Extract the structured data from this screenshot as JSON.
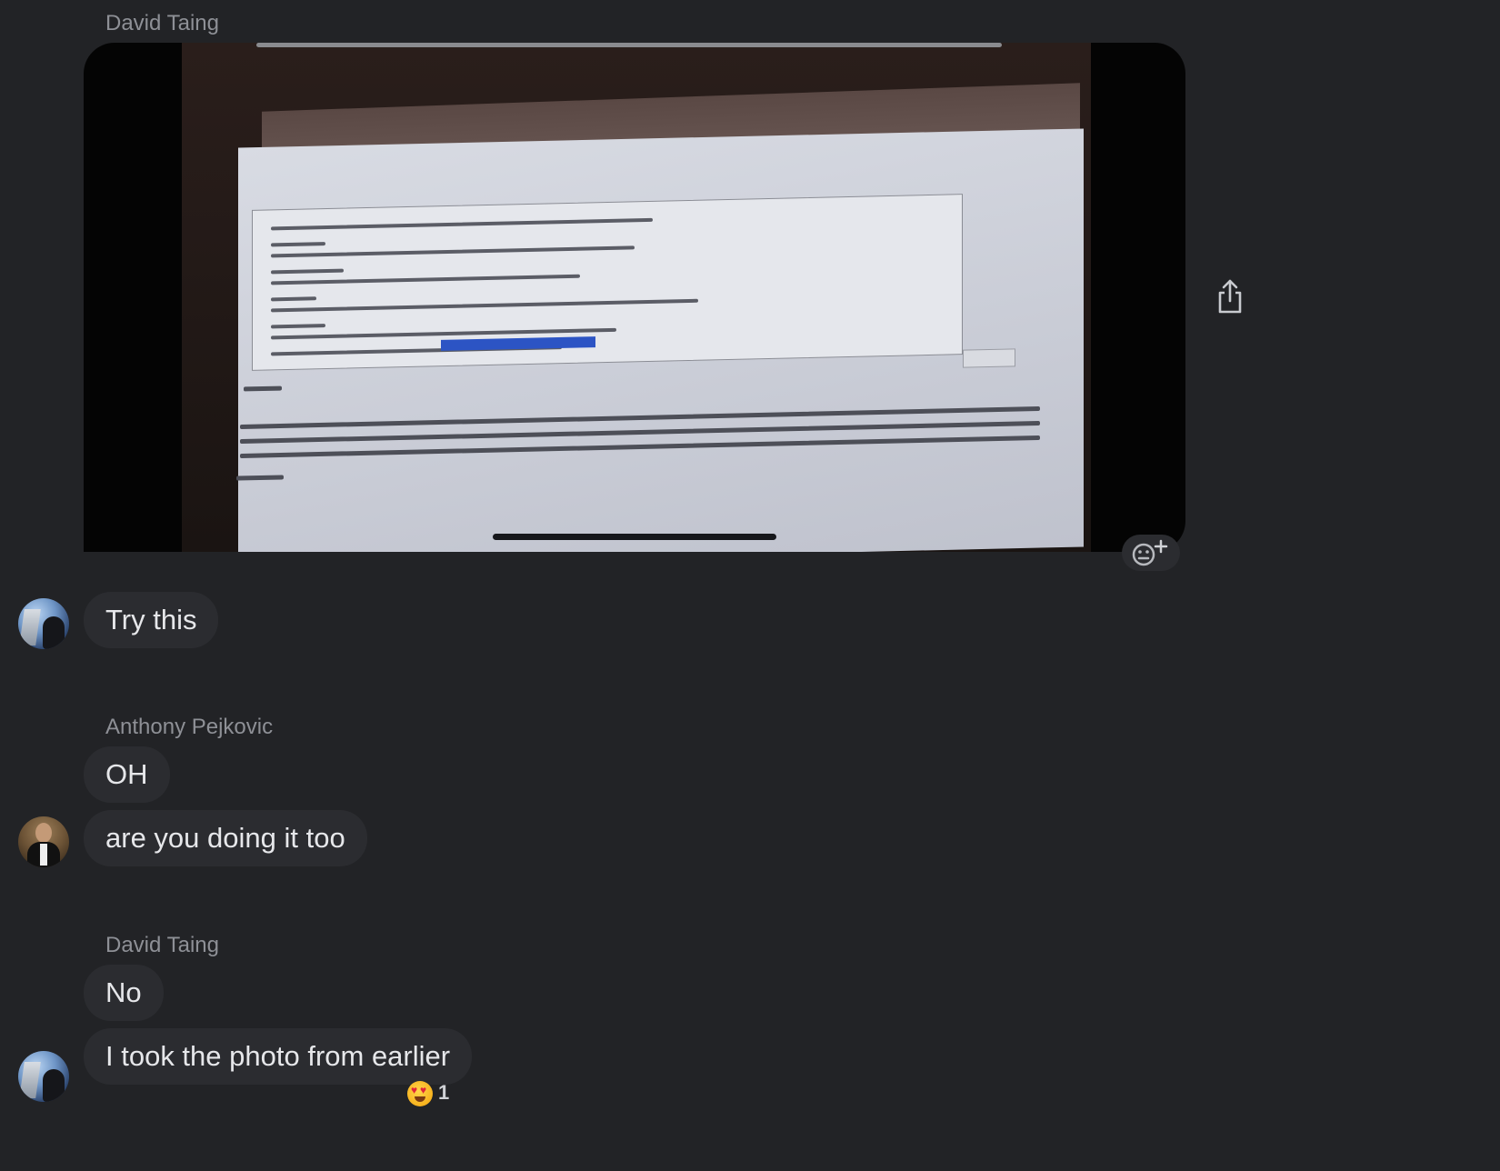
{
  "messages": [
    {
      "sender": "David Taing",
      "type": "photo"
    },
    {
      "text": "Try this"
    },
    {
      "sender": "Anthony Pejkovic"
    },
    {
      "text": "OH"
    },
    {
      "text": "are you doing it too"
    },
    {
      "sender": "David Taing"
    },
    {
      "text": "No"
    },
    {
      "text": "I took the photo from earlier",
      "reaction": {
        "emoji": "heart-eyes",
        "count": "1"
      }
    }
  ],
  "icons": {
    "share": "share-icon",
    "add_reaction": "add-reaction-icon"
  },
  "colors": {
    "background": "#222326",
    "bubble": "#2b2c30",
    "sender_name": "#8e9096",
    "text": "#e6e7ea"
  }
}
